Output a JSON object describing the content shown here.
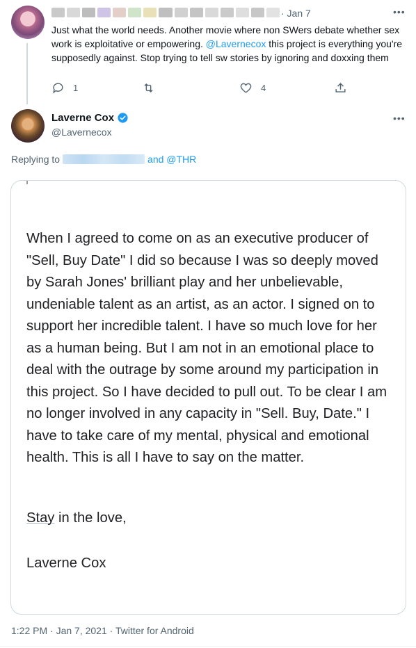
{
  "tweet1": {
    "date": "· Jan 7",
    "text_before": "Just what the world needs. Another movie where non SWers debate whether sex work is exploitative or empowering. ",
    "mention": "@Lavernecox",
    "text_after": " this project is everything you're supposedly against. Stop trying to tell sw stories by ignoring and doxxing them",
    "reply_count": "1",
    "retweet_count": "",
    "like_count": "4"
  },
  "tweet2": {
    "display_name": "Laverne Cox",
    "handle": "@Lavernecox",
    "replying_prefix": "Replying to",
    "replying_suffix": "and @THR",
    "statement": "When I agreed to come on as an executive producer of \"Sell, Buy Date\" I did so because I was so deeply moved by Sarah Jones' brilliant play and her unbelievable,  undeniable talent as an artist, as an actor. I signed on to support her incredible talent.  I have so much love for her as a human being.  But I am not in an emotional place to deal with the outrage by some around my participation in this project.  So I have decided to pull out. To be clear I am no longer involved in any capacity in \"Sell. Buy, Date.\" I have to take care of my mental, physical and emotional health.  This is all I have to say on the matter.",
    "closing_word": "Stay",
    "closing_rest": " in the love,",
    "signature": "Laverne Cox",
    "timestamp": "1:22 PM · Jan 7, 2021 · Twitter for Android"
  },
  "icons": {
    "reply": "reply-icon",
    "retweet": "retweet-icon",
    "like": "like-icon",
    "share": "share-icon",
    "verified": "verified-badge-icon",
    "more": "more-options-icon"
  },
  "colors": {
    "link": "#1d9bf0",
    "muted": "#536471",
    "text": "#0f1419",
    "border": "#cfd9de"
  }
}
